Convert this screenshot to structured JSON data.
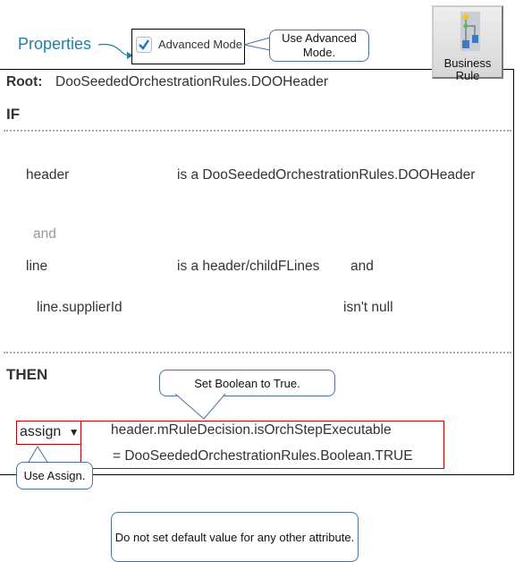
{
  "properties_label": "Properties",
  "advanced_mode": {
    "label": "Advanced Mode",
    "checked": true
  },
  "business_rule_button": {
    "line1": "Business",
    "line2": "Rule"
  },
  "rule": {
    "root_label": "Root:",
    "root_value": "DooSeededOrchestrationRules.DOOHeader",
    "if_label": "IF",
    "conditions": [
      {
        "var": "header",
        "op": "is a DooSeededOrchestrationRules.DOOHeader"
      },
      {
        "connector": "and"
      },
      {
        "var": "line",
        "op": "is a header/childFLines",
        "trailing": "and"
      },
      {
        "var": "line.supplierId",
        "op": "isn't null"
      }
    ],
    "then_label": "THEN",
    "action": {
      "type": "assign",
      "target": "header.mRuleDecision.isOrchStepExecutable",
      "value": "= DooSeededOrchestrationRules.Boolean.TRUE"
    }
  },
  "callouts": {
    "advanced": "Use Advanced Mode.",
    "boolean": "Set Boolean  to True.",
    "assign": "Use Assign.",
    "default": "Do not set default value  for any other attribute."
  },
  "colors": {
    "properties": "#1f7fa6",
    "highlight": "#c00000",
    "callout_border": "#4a74a0",
    "checkbox": "#1a73c8"
  }
}
